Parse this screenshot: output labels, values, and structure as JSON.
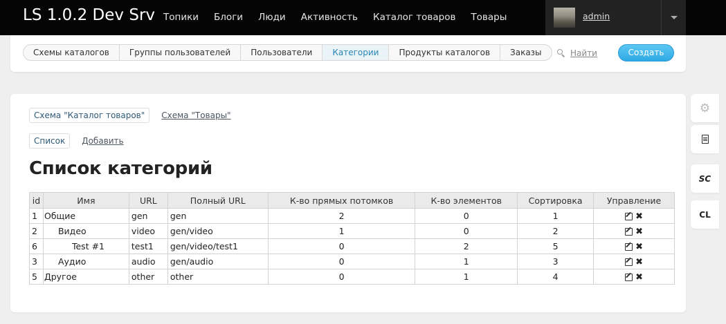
{
  "brand": "LS 1.0.2 Dev Srv",
  "topnav": [
    "Топики",
    "Блоги",
    "Люди",
    "Активность",
    "Каталог товаров",
    "Товары"
  ],
  "user": {
    "name": "admin"
  },
  "admin_tabs": {
    "items": [
      "Схемы каталогов",
      "Группы пользователей",
      "Пользователи",
      "Категории",
      "Продукты каталогов",
      "Заказы"
    ],
    "active": "Категории"
  },
  "search_label": "Найти",
  "create_label": "Создать",
  "schemes": [
    "Схема \"Каталог товаров\"",
    "Схема \"Товары\""
  ],
  "sub_actions": {
    "list": "Список",
    "add": "Добавить"
  },
  "page_title": "Список категорий",
  "table": {
    "headers": [
      "id",
      "Имя",
      "URL",
      "Полный URL",
      "К-во прямых потомков",
      "К-во элементов",
      "Сортировка",
      "Управление"
    ],
    "rows": [
      {
        "id": "1",
        "name": "Общие",
        "url": "gen",
        "full_url": "gen",
        "children": "2",
        "elements": "0",
        "sort": "1",
        "depth": 0
      },
      {
        "id": "2",
        "name": "Видео",
        "url": "video",
        "full_url": "gen/video",
        "children": "1",
        "elements": "0",
        "sort": "2",
        "depth": 1
      },
      {
        "id": "6",
        "name": "Test #1",
        "url": "test1",
        "full_url": "gen/video/test1",
        "children": "0",
        "elements": "2",
        "sort": "5",
        "depth": 2
      },
      {
        "id": "3",
        "name": "Аудио",
        "url": "audio",
        "full_url": "gen/audio",
        "children": "0",
        "elements": "1",
        "sort": "3",
        "depth": 1
      },
      {
        "id": "5",
        "name": "Другое",
        "url": "other",
        "full_url": "other",
        "children": "0",
        "elements": "1",
        "sort": "4",
        "depth": 0
      }
    ]
  },
  "side_widgets": {
    "sc": "SC",
    "cl": "CL"
  },
  "colors": {
    "accent": "#2fa9e4",
    "topbar": "#050505",
    "active_tab_text": "#2a86b5"
  }
}
